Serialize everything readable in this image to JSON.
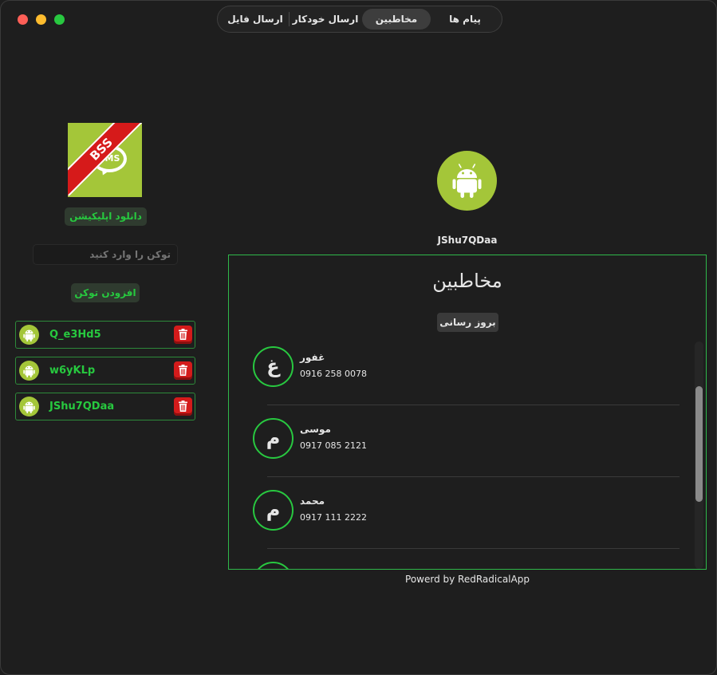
{
  "window": {
    "title": ""
  },
  "tabs": [
    {
      "label": "پیام ها"
    },
    {
      "label": "مخاطبین",
      "selected": true
    },
    {
      "label": "ارسال خودکار"
    },
    {
      "label": "ارسال فایل"
    }
  ],
  "sidebar": {
    "logo": {
      "ribbon_text": "BSS",
      "bubble_text": "SMS"
    },
    "download_label": "دانلود اپلیکیشن",
    "token_input": {
      "placeholder": "توکن را وارد کنید",
      "value": ""
    },
    "add_token_label": "افزودن توکن",
    "tokens": [
      {
        "label": "Q_e3Hd5"
      },
      {
        "label": "w6yKLp"
      },
      {
        "label": "JShu7QDaa"
      }
    ]
  },
  "main": {
    "device_name": "JShu7QDaa",
    "contacts_title": "مخاطبین",
    "refresh_label": "بروز رسانی",
    "contacts": [
      {
        "initial": "غ",
        "name": "غفور",
        "phone": "0916 258 0078"
      },
      {
        "initial": "م",
        "name": "موسی",
        "phone": "0917 085 2121"
      },
      {
        "initial": "م",
        "name": "محمد",
        "phone": "0917 111 2222"
      }
    ],
    "scroll_position": 0.2
  },
  "footer": {
    "text": "Powerd by RedRadicalApp"
  },
  "colors": {
    "accent_green": "#27c93f",
    "android_green": "#a4c639",
    "delete_red": "#d41b1b",
    "background": "#1e1e1e"
  },
  "icons": {
    "token_avatar": "android-icon",
    "delete": "trash-icon",
    "main_avatar": "android-icon"
  }
}
